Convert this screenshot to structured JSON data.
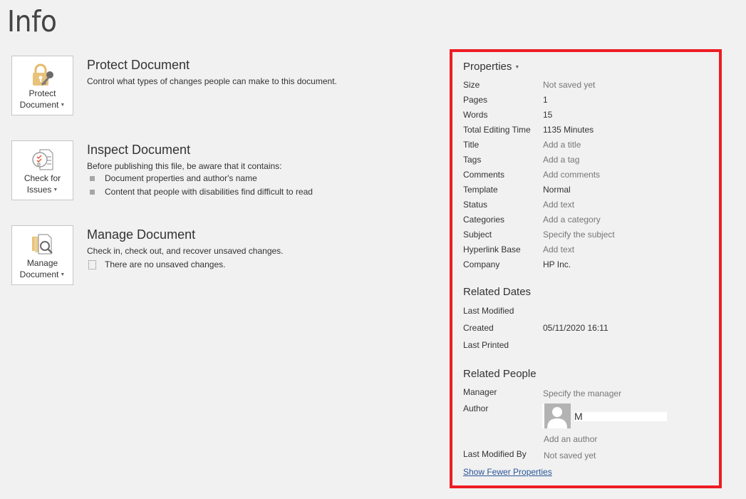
{
  "page": {
    "title": "Info"
  },
  "actions": [
    {
      "button_line1": "Protect",
      "button_line2": "Document",
      "heading": "Protect Document",
      "description": "Control what types of changes people can make to this document.",
      "icon": "lock-key-icon"
    },
    {
      "button_line1": "Check for",
      "button_line2": "Issues",
      "heading": "Inspect Document",
      "description": "Before publishing this file, be aware that it contains:",
      "bullets": [
        "Document properties and author's name",
        "Content that people with disabilities find difficult to read"
      ],
      "icon": "checklist-icon"
    },
    {
      "button_line1": "Manage",
      "button_line2": "Document",
      "heading": "Manage Document",
      "description": "Check in, check out, and recover unsaved changes.",
      "note": "There are no unsaved changes.",
      "icon": "manage-documents-icon"
    }
  ],
  "properties": {
    "heading": "Properties",
    "rows": [
      {
        "key": "Size",
        "value": "Not saved yet"
      },
      {
        "key": "Pages",
        "value": "1"
      },
      {
        "key": "Words",
        "value": "15"
      },
      {
        "key": "Total Editing Time",
        "value": "1135 Minutes"
      },
      {
        "key": "Title",
        "value": "Add a title"
      },
      {
        "key": "Tags",
        "value": "Add a tag"
      },
      {
        "key": "Comments",
        "value": "Add comments"
      },
      {
        "key": "Template",
        "value": "Normal"
      },
      {
        "key": "Status",
        "value": "Add text"
      },
      {
        "key": "Categories",
        "value": "Add a category"
      },
      {
        "key": "Subject",
        "value": "Specify the subject"
      },
      {
        "key": "Hyperlink Base",
        "value": "Add text"
      },
      {
        "key": "Company",
        "value": "HP Inc."
      }
    ]
  },
  "related_dates": {
    "heading": "Related Dates",
    "rows": [
      {
        "key": "Last Modified",
        "value": ""
      },
      {
        "key": "Created",
        "value": "05/11/2020 16:11"
      },
      {
        "key": "Last Printed",
        "value": ""
      }
    ]
  },
  "related_people": {
    "heading": "Related People",
    "manager_label": "Manager",
    "manager_value": "Specify the manager",
    "author_label": "Author",
    "author_initial": "M",
    "add_author": "Add an author",
    "last_modified_by_label": "Last Modified By",
    "last_modified_by_value": "Not saved yet"
  },
  "show_fewer_link": "Show Fewer Properties",
  "colors": {
    "highlight_frame": "#ed1c24",
    "link": "#2a5699"
  }
}
